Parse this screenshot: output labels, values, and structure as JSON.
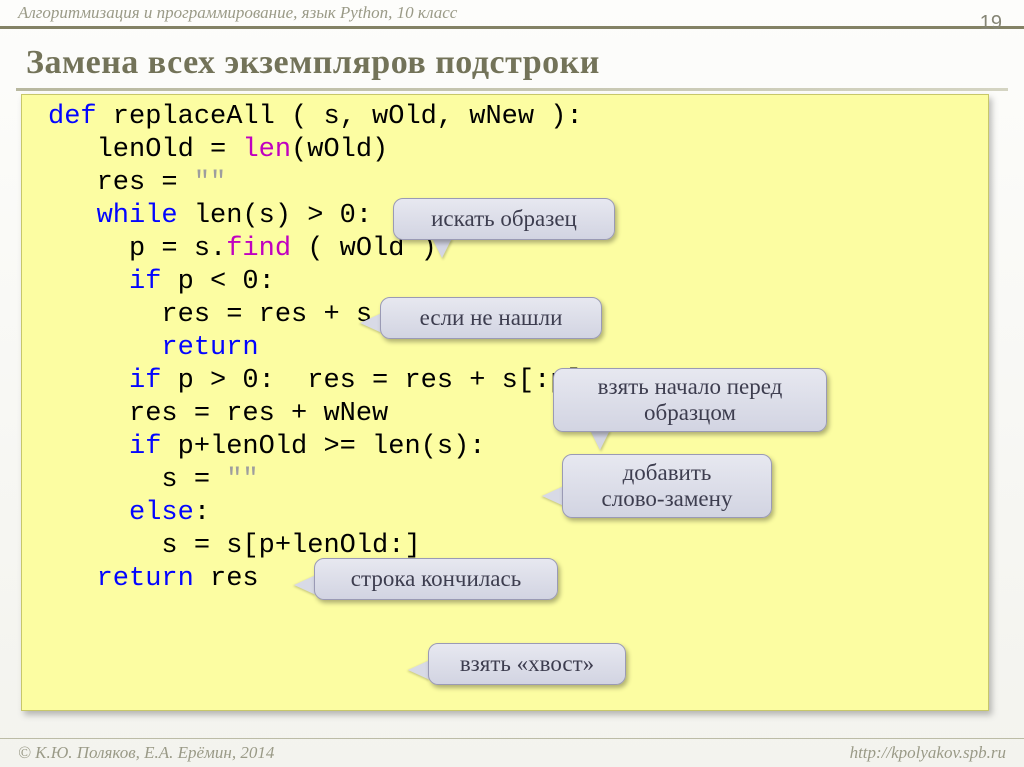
{
  "header": {
    "breadcrumb": "Алгоритмизация и программирование, язык Python, 10 класс"
  },
  "slide_number": "19",
  "title": "Замена всех экземпляров подстроки",
  "code": {
    "l1a": "def",
    "l1b": " replaceAll ( s, wOld, wNew ):",
    "l2a": "   lenOld = ",
    "l2b": "len",
    "l2c": "(wOld)",
    "l3a": "   res = ",
    "l3b": "\"\"",
    "l4a": "   ",
    "l4b": "while",
    "l4c": " len(s) > 0:",
    "l5a": "     p = s.",
    "l5b": "find",
    "l5c": " ( wOld )",
    "l6a": "     ",
    "l6b": "if",
    "l6c": " p < 0:",
    "l7": "       res = res + s",
    "l8a": "       ",
    "l8b": "return",
    "l9a": "     ",
    "l9b": "if",
    "l9c": " p > 0:  res = res + s[:p]",
    "l10": "     res = res + wNew",
    "l11a": "     ",
    "l11b": "if",
    "l11c": " p+lenOld >= len(s):",
    "l12a": "       s = ",
    "l12b": "\"\"",
    "l13a": "     ",
    "l13b": "else",
    "l13c": ":",
    "l14": "       s = s[p+lenOld:]",
    "l15a": "   ",
    "l15b": "return",
    "l15c": " res"
  },
  "callouts": {
    "c1": "искать образец",
    "c2": "если не нашли",
    "c3": "взять начало перед\nобразцом",
    "c4": "добавить\nслово-замену",
    "c5": "строка кончилась",
    "c6": "взять «хвост»"
  },
  "footer": {
    "left": "© К.Ю. Поляков, Е.А. Ерёмин, 2014",
    "right": "http://kpolyakov.spb.ru"
  }
}
